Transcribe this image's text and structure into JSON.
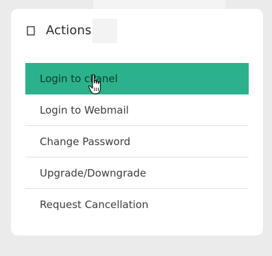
{
  "panel": {
    "title": "Actions",
    "header_icon": "square-outline-icon"
  },
  "actions": [
    {
      "label": "Login to cPanel",
      "active": true
    },
    {
      "label": "Login to Webmail",
      "active": false
    },
    {
      "label": "Change Password",
      "active": false
    },
    {
      "label": "Upgrade/Downgrade",
      "active": false
    },
    {
      "label": "Request Cancellation",
      "active": false
    }
  ],
  "colors": {
    "accent": "#2bb28c",
    "background": "#ebebeb",
    "panel": "#ffffff"
  },
  "cursor_icon": "hand-pointer-icon"
}
